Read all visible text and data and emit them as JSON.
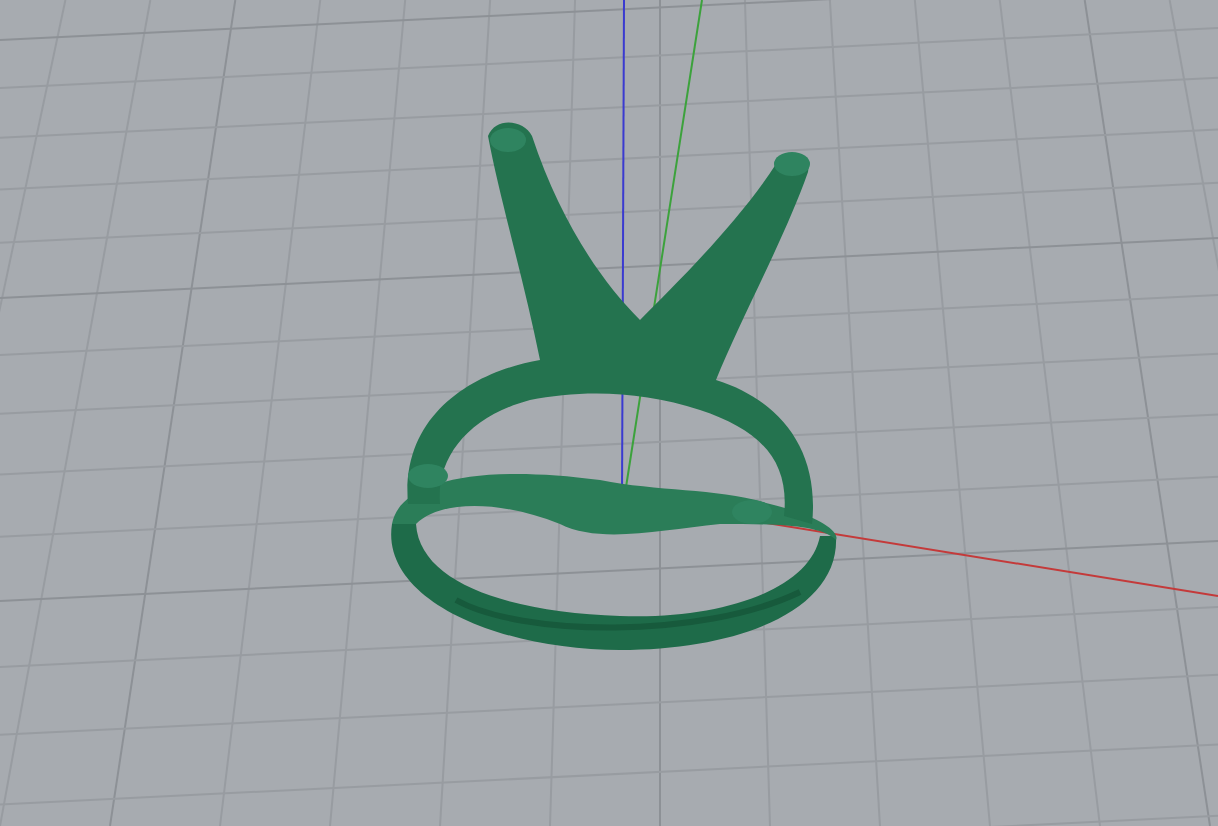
{
  "viewport": {
    "kind": "perspective",
    "show_grid": true,
    "show_axes": true
  }
}
